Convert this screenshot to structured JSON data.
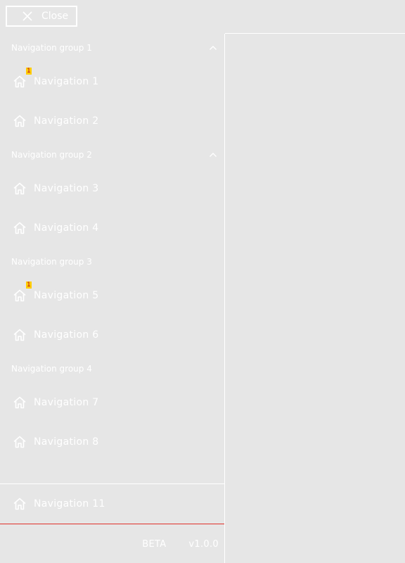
{
  "close_button": {
    "label": "Close"
  },
  "groups": [
    {
      "title": "Navigation group 1",
      "collapsible": true,
      "items": [
        {
          "label": "Navigation 1",
          "badge": "1"
        },
        {
          "label": "Navigation 2"
        }
      ]
    },
    {
      "title": "Navigation group 2",
      "collapsible": true,
      "items": [
        {
          "label": "Navigation 3"
        },
        {
          "label": "Navigation 4"
        }
      ]
    },
    {
      "title": "Navigation group 3",
      "collapsible": false,
      "items": [
        {
          "label": "Navigation 5",
          "badge": "1"
        },
        {
          "label": "Navigation 6"
        }
      ]
    },
    {
      "title": "Navigation group 4",
      "collapsible": false,
      "items": [
        {
          "label": "Navigation 7"
        },
        {
          "label": "Navigation 8"
        }
      ]
    }
  ],
  "pinned_item": {
    "label": "Navigation 11"
  },
  "footer": {
    "beta": "BETA",
    "version": "v1.0.0"
  },
  "colors": {
    "foreground": "#ffffff",
    "background": "#e6e6e6",
    "accent_line": "#e0302a",
    "badge_bg": "#ffcc00",
    "badge_text": "#b3002e"
  },
  "icons": {
    "close": "close-icon",
    "nav": "home-icon",
    "collapse": "chevron-up-icon"
  }
}
